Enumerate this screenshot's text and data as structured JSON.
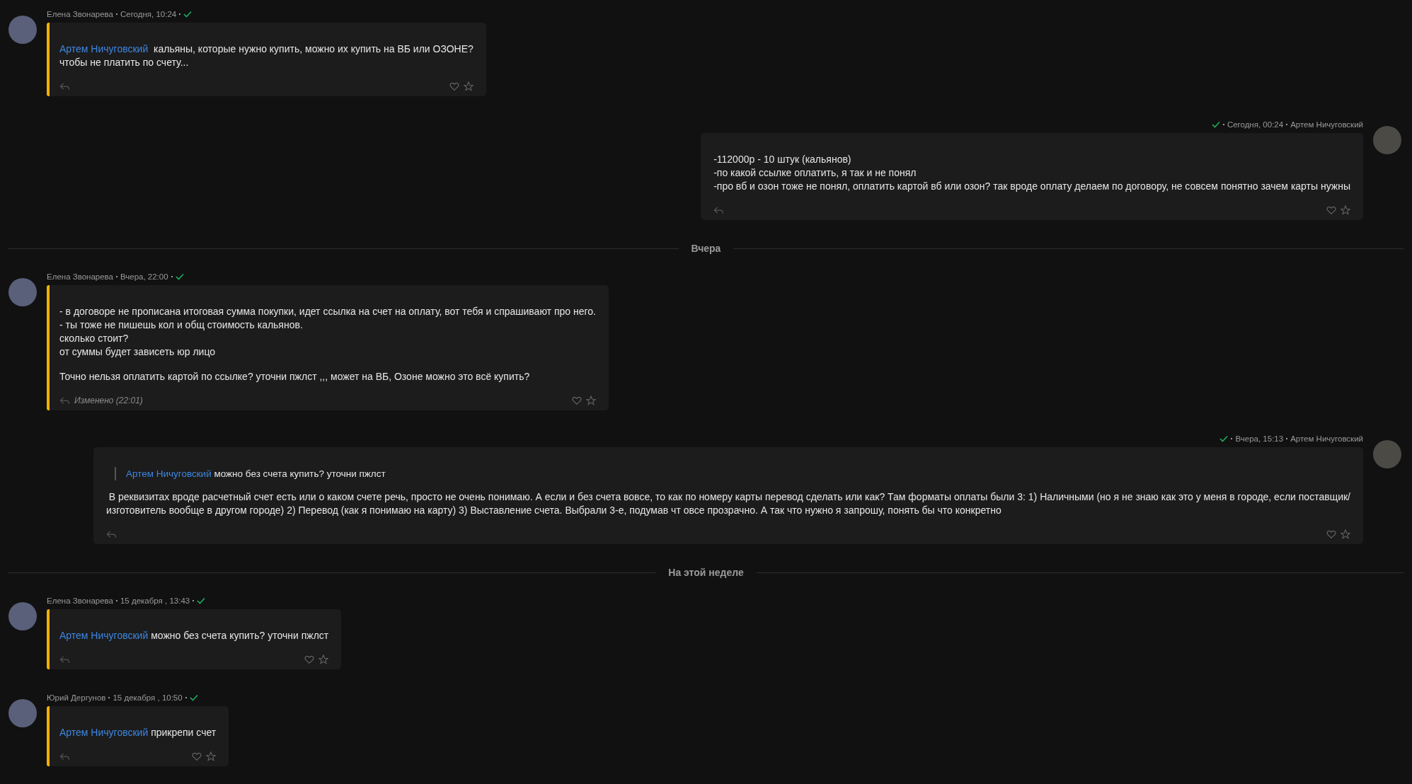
{
  "feed": [
    {
      "kind": "incoming",
      "author": "Елена Звонарева",
      "time": "Сегодня, 10:24",
      "read": true,
      "highlighted": true,
      "mention": "Артем Ничуговский ",
      "paragraphs": [
        [
          "кальяны, которые нужно купить, можно их купить на ВБ или ОЗОНЕ?",
          "чтобы не платить по счету..."
        ]
      ]
    },
    {
      "kind": "outgoing",
      "author": "Артем Ничуговский",
      "time": "Сегодня, 00:24",
      "read": true,
      "highlighted": false,
      "paragraphs": [
        [
          "-112000р - 10 штук (кальянов)",
          "-по какой ссылке оплатить, я так и не понял",
          "-про вб и озон тоже не понял, оплатить картой вб или озон? так вроде оплату делаем по договору, не совсем понятно зачем карты нужны"
        ]
      ]
    },
    {
      "kind": "divider",
      "label": "Вчера"
    },
    {
      "kind": "incoming",
      "author": "Елена Звонарева",
      "time": "Вчера, 22:00",
      "read": true,
      "highlighted": true,
      "edited": "Изменено (22:01)",
      "paragraphs": [
        [
          "- в договоре не прописана итоговая сумма покупки, идет ссылка на счет на оплату, вот тебя и спрашивают про него.",
          "- ты тоже не пишешь кол и общ стоимость кальянов.",
          "сколько стоит?",
          "от суммы будет зависеть юр лицо"
        ],
        [
          "Точно нельзя оплатить картой по ссылке? уточни пжлст ,,, может на ВБ, Озоне можно это всё купить?"
        ]
      ]
    },
    {
      "kind": "outgoing",
      "author": "Артем Ничуговский",
      "time": "Вчера, 15:13",
      "read": true,
      "highlighted": false,
      "quote": {
        "mention": "Артем Ничуговский",
        "text": "можно без счета купить? уточни пжлст"
      },
      "paragraphs": [
        [
          " В реквизитах вроде расчетный счет есть или о каком счете речь, просто не очень понимаю. А если и без счета вовсе, то как по номеру карты перевод сделать или как? Там форматы оплаты были 3: 1) Наличными (но я не знаю как это у меня в городе, если поставщик/",
          "изготовитель вообще в другом городе) 2) Перевод (как я понимаю на карту) 3) Выставление счета. Выбрали 3-е, подумав чт овсе прозрачно. А так что нужно я запрошу, понять бы что конкретно"
        ]
      ]
    },
    {
      "kind": "divider",
      "label": "На этой неделе"
    },
    {
      "kind": "incoming",
      "author": "Елена Звонарева",
      "time": "15 декабря , 13:43",
      "read": true,
      "highlighted": true,
      "mention": "Артем Ничуговский",
      "paragraphs": [
        [
          "можно без счета купить? уточни пжлст"
        ]
      ]
    },
    {
      "kind": "incoming",
      "author": "Юрий Дергунов",
      "time": "15 декабря , 10:50",
      "read": true,
      "highlighted": true,
      "mention": "Артем Ничуговский",
      "paragraphs": [
        [
          "прикрепи счет"
        ]
      ]
    }
  ]
}
